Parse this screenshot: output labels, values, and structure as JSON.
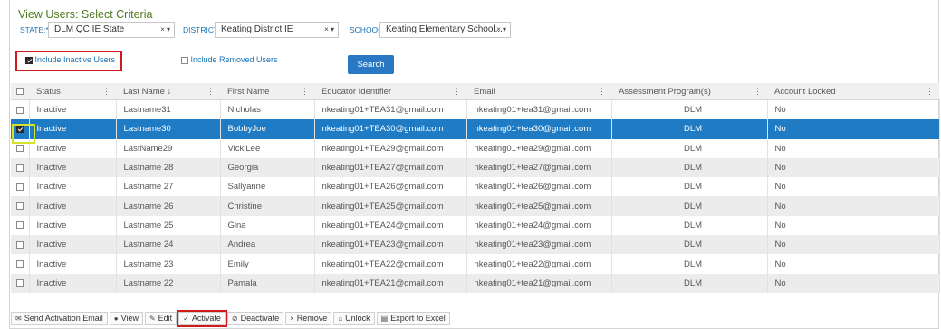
{
  "title": "View Users: Select Criteria",
  "filters": {
    "state_label": "STATE:*",
    "state_value": "DLM QC IE State",
    "district_label": "DISTRICT",
    "district_value": "Keating District IE",
    "school_label": "SCHOOL",
    "school_value": "Keating Elementary School...",
    "clear_icon": "×",
    "caret_icon": "▾"
  },
  "options": {
    "include_inactive_label": "Include Inactive Users",
    "include_inactive_checked": true,
    "include_removed_label": "Include Removed Users",
    "include_removed_checked": false
  },
  "search_label": "Search",
  "columns": [
    "Status",
    "Last Name ↓",
    "First Name",
    "Educator Identifier",
    "Email",
    "Assessment Program(s)",
    "Account Locked"
  ],
  "column_menu_glyph": "⋮",
  "rows": [
    {
      "status": "Inactive",
      "last": "Lastname31",
      "first": "Nicholas",
      "educator_id": "nkeating01+TEA31@gmail.com",
      "email": "nkeating01+tea31@gmail.com",
      "program": "DLM",
      "locked": "No",
      "selected": false
    },
    {
      "status": "Inactive",
      "last": "Lastname30",
      "first": "BobbyJoe",
      "educator_id": "nkeating01+TEA30@gmail.com",
      "email": "nkeating01+tea30@gmail.com",
      "program": "DLM",
      "locked": "No",
      "selected": true
    },
    {
      "status": "Inactive",
      "last": "LastName29",
      "first": "VickiLee",
      "educator_id": "nkeating01+TEA29@gmail.com",
      "email": "nkeating01+tea29@gmail.com",
      "program": "DLM",
      "locked": "No",
      "selected": false
    },
    {
      "status": "Inactive",
      "last": "Lastname 28",
      "first": "Georgia",
      "educator_id": "nkeating01+TEA27@gmail.com",
      "email": "nkeating01+tea27@gmail.com",
      "program": "DLM",
      "locked": "No",
      "selected": false
    },
    {
      "status": "Inactive",
      "last": "Lastname 27",
      "first": "Sallyanne",
      "educator_id": "nkeating01+TEA26@gmail.com",
      "email": "nkeating01+tea26@gmail.com",
      "program": "DLM",
      "locked": "No",
      "selected": false
    },
    {
      "status": "Inactive",
      "last": "Lastname 26",
      "first": "Christine",
      "educator_id": "nkeating01+TEA25@gmail.com",
      "email": "nkeating01+tea25@gmail.com",
      "program": "DLM",
      "locked": "No",
      "selected": false
    },
    {
      "status": "Inactive",
      "last": "Lastname 25",
      "first": "Gina",
      "educator_id": "nkeating01+TEA24@gmail.com",
      "email": "nkeating01+tea24@gmail.com",
      "program": "DLM",
      "locked": "No",
      "selected": false
    },
    {
      "status": "Inactive",
      "last": "Lastname 24",
      "first": "Andrea",
      "educator_id": "nkeating01+TEA23@gmail.com",
      "email": "nkeating01+tea23@gmail.com",
      "program": "DLM",
      "locked": "No",
      "selected": false
    },
    {
      "status": "Inactive",
      "last": "Lastname 23",
      "first": "Emily",
      "educator_id": "nkeating01+TEA22@gmail.com",
      "email": "nkeating01+tea22@gmail.com",
      "program": "DLM",
      "locked": "No",
      "selected": false
    },
    {
      "status": "Inactive",
      "last": "Lastname 22",
      "first": "Pamala",
      "educator_id": "nkeating01+TEA21@gmail.com",
      "email": "nkeating01+tea21@gmail.com",
      "program": "DLM",
      "locked": "No",
      "selected": false
    }
  ],
  "toolbar": [
    {
      "name": "send-activation-email-button",
      "icon": "envelope-icon",
      "glyph": "✉",
      "label": "Send Activation Email",
      "highlighted": false
    },
    {
      "name": "view-button",
      "icon": "eye-icon",
      "glyph": "●",
      "label": "View",
      "highlighted": false
    },
    {
      "name": "edit-button",
      "icon": "pencil-icon",
      "glyph": "✎",
      "label": "Edit",
      "highlighted": false
    },
    {
      "name": "activate-button",
      "icon": "checkmark-icon",
      "glyph": "✓",
      "label": "Activate",
      "highlighted": true
    },
    {
      "name": "deactivate-button",
      "icon": "ban-icon",
      "glyph": "⊘",
      "label": "Deactivate",
      "highlighted": false
    },
    {
      "name": "remove-button",
      "icon": "x-icon",
      "glyph": "×",
      "label": "Remove",
      "highlighted": false
    },
    {
      "name": "unlock-button",
      "icon": "unlock-icon",
      "glyph": "⌂",
      "label": "Unlock",
      "highlighted": false
    },
    {
      "name": "export-to-excel-button",
      "icon": "excel-icon",
      "glyph": "▤",
      "label": "Export to Excel",
      "highlighted": false
    }
  ],
  "colors": {
    "title_green": "#4d7a1c",
    "link_blue": "#1a73b8",
    "selected_row": "#1e7bc4",
    "highlight_red": "#d11a1a",
    "selected_checkbox_outline": "#d6e22a"
  }
}
